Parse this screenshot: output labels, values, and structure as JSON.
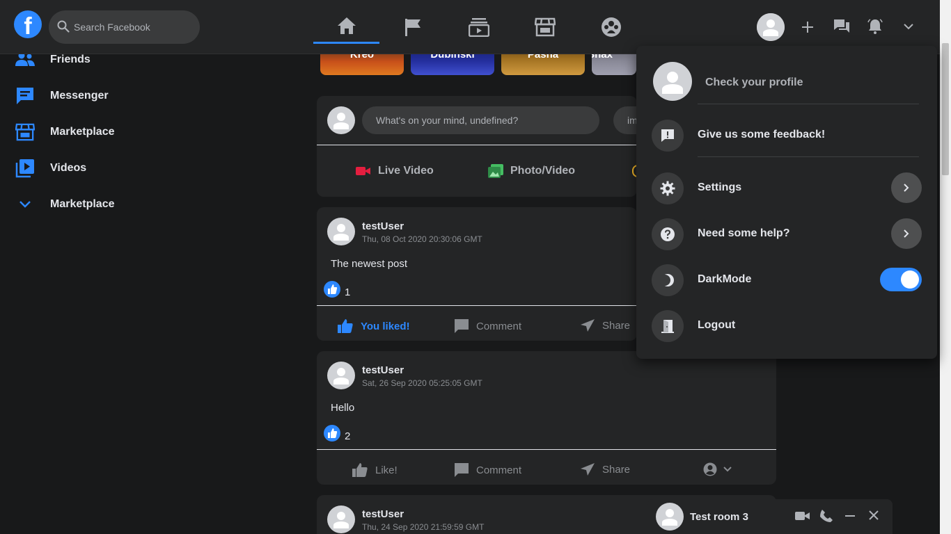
{
  "app": {
    "brand_color": "#2d88ff"
  },
  "header": {
    "logo_letter": "f",
    "search_placeholder": "Search Facebook",
    "tabs": [
      {
        "icon": "home-icon",
        "active": true
      },
      {
        "icon": "flag-icon",
        "active": false
      },
      {
        "icon": "watch-icon",
        "active": false
      },
      {
        "icon": "marketplace-icon",
        "active": false
      },
      {
        "icon": "groups-icon",
        "active": false
      }
    ]
  },
  "sidebar": {
    "items": [
      {
        "label": "Friends",
        "icon": "friends-icon"
      },
      {
        "label": "Messenger",
        "icon": "messenger-icon"
      },
      {
        "label": "Marketplace",
        "icon": "marketplace-icon"
      },
      {
        "label": "Videos",
        "icon": "videos-icon"
      },
      {
        "label": "Marketplace",
        "icon": "chevron-down-icon"
      }
    ]
  },
  "stories": [
    {
      "name": "Kreo"
    },
    {
      "name": "Dubinski"
    },
    {
      "name": "Pasha"
    },
    {
      "name": "Shax"
    }
  ],
  "composer": {
    "prompt": "What's on your mind, undefined?",
    "second_pill": "im",
    "live_video": "Live Video",
    "photo_video": "Photo/Video"
  },
  "posts": [
    {
      "author": "testUser",
      "date": "Thu, 08 Oct 2020 20:30:06 GMT",
      "text": "The newest post",
      "likes": "1",
      "like_label": "You liked!",
      "comment_label": "Comment",
      "share_label": "Share"
    },
    {
      "author": "testUser",
      "date": "Sat, 26 Sep 2020 05:25:05 GMT",
      "text": "Hello",
      "likes": "2",
      "like_label": "Like!",
      "comment_label": "Comment",
      "share_label": "Share"
    },
    {
      "author": "testUser",
      "date": "Thu, 24 Sep 2020 21:59:59 GMT"
    }
  ],
  "menu": {
    "profile": "Check your profile",
    "feedback": "Give us some feedback!",
    "settings": "Settings",
    "help": "Need some help?",
    "darkmode": "DarkMode",
    "darkmode_on": true,
    "logout": "Logout"
  },
  "chat": {
    "room": "Test room 3"
  }
}
